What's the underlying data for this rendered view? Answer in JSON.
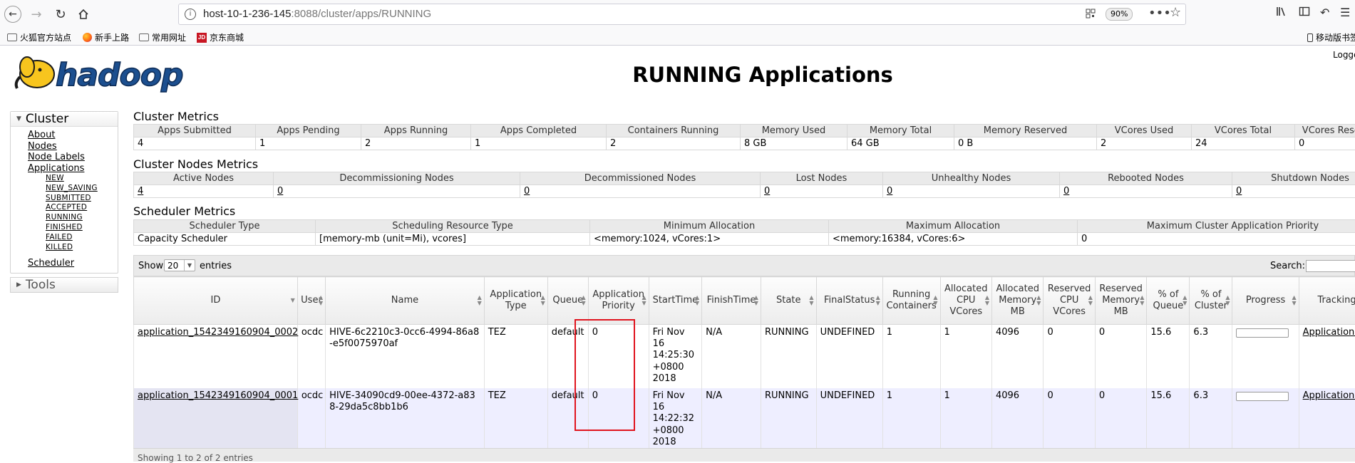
{
  "browser": {
    "url_host": "host-10-1-236-145",
    "url_rest": ":8088/cluster/apps/RUNNING",
    "zoom": "90%",
    "bookmarks": [
      "火狐官方站点",
      "新手上路",
      "常用网址",
      "京东商城"
    ],
    "mobile_bookmarks": "移动版书签"
  },
  "page": {
    "title": "RUNNING Applications",
    "logged_in": "Logged in as: dr.who",
    "logo_text": "hadoop"
  },
  "nav": {
    "cluster_label": "Cluster",
    "links": [
      "About",
      "Nodes",
      "Node Labels",
      "Applications"
    ],
    "app_states": [
      "NEW",
      "NEW_SAVING",
      "SUBMITTED",
      "ACCEPTED",
      "RUNNING",
      "FINISHED",
      "FAILED",
      "KILLED"
    ],
    "scheduler": "Scheduler",
    "tools_label": "Tools"
  },
  "cluster_metrics": {
    "label": "Cluster Metrics",
    "headers": [
      "Apps Submitted",
      "Apps Pending",
      "Apps Running",
      "Apps Completed",
      "Containers Running",
      "Memory Used",
      "Memory Total",
      "Memory Reserved",
      "VCores Used",
      "VCores Total",
      "VCores Reserved"
    ],
    "values": [
      "4",
      "1",
      "2",
      "1",
      "2",
      "8 GB",
      "64 GB",
      "0 B",
      "2",
      "24",
      "0"
    ]
  },
  "nodes_metrics": {
    "label": "Cluster Nodes Metrics",
    "headers": [
      "Active Nodes",
      "Decommissioning Nodes",
      "Decommissioned Nodes",
      "Lost Nodes",
      "Unhealthy Nodes",
      "Rebooted Nodes",
      "Shutdown Nodes"
    ],
    "values": [
      "4",
      "0",
      "0",
      "0",
      "0",
      "0",
      "0"
    ]
  },
  "scheduler_metrics": {
    "label": "Scheduler Metrics",
    "headers": [
      "Scheduler Type",
      "Scheduling Resource Type",
      "Minimum Allocation",
      "Maximum Allocation",
      "Maximum Cluster Application Priority"
    ],
    "values": [
      "Capacity Scheduler",
      "[memory-mb (unit=Mi), vcores]",
      "<memory:1024, vCores:1>",
      "<memory:16384, vCores:6>",
      "0"
    ]
  },
  "apps_table": {
    "show_label": "Show",
    "page_length": "20",
    "entries_label": "entries",
    "search_label": "Search:",
    "headers": [
      "ID",
      "User",
      "Name",
      "Application Type",
      "Queue",
      "Application Priority",
      "StartTime",
      "FinishTime",
      "State",
      "FinalStatus",
      "Running Containers",
      "Allocated CPU VCores",
      "Allocated Memory MB",
      "Reserved CPU VCores",
      "Reserved Memory MB",
      "% of Queue",
      "% of Cluster",
      "Progress",
      "Tracking UI"
    ],
    "rows": [
      {
        "id": "application_1542349160904_0002",
        "user": "ocdc",
        "name": "HIVE-6c2210c3-0cc6-4994-86a8-e5f0075970af",
        "type": "TEZ",
        "queue": "default",
        "priority": "0",
        "start": "Fri Nov 16 14:25:30 +0800 2018",
        "finish": "N/A",
        "state": "RUNNING",
        "final": "UNDEFINED",
        "containers": "1",
        "alloc_cpu": "1",
        "alloc_mem": "4096",
        "res_cpu": "0",
        "res_mem": "0",
        "pct_queue": "15.6",
        "pct_cluster": "6.3",
        "progress": 0,
        "tracking": "ApplicationMaster"
      },
      {
        "id": "application_1542349160904_0001",
        "user": "ocdc",
        "name": "HIVE-34090cd9-00ee-4372-a838-29da5c8bb1b6",
        "type": "TEZ",
        "queue": "default",
        "priority": "0",
        "start": "Fri Nov 16 14:22:32 +0800 2018",
        "finish": "N/A",
        "state": "RUNNING",
        "final": "UNDEFINED",
        "containers": "1",
        "alloc_cpu": "1",
        "alloc_mem": "4096",
        "res_cpu": "0",
        "res_mem": "0",
        "pct_queue": "15.6",
        "pct_cluster": "6.3",
        "progress": 0,
        "tracking": "ApplicationMaster"
      }
    ],
    "footer_info": "Showing 1 to 2 of 2 entries"
  }
}
